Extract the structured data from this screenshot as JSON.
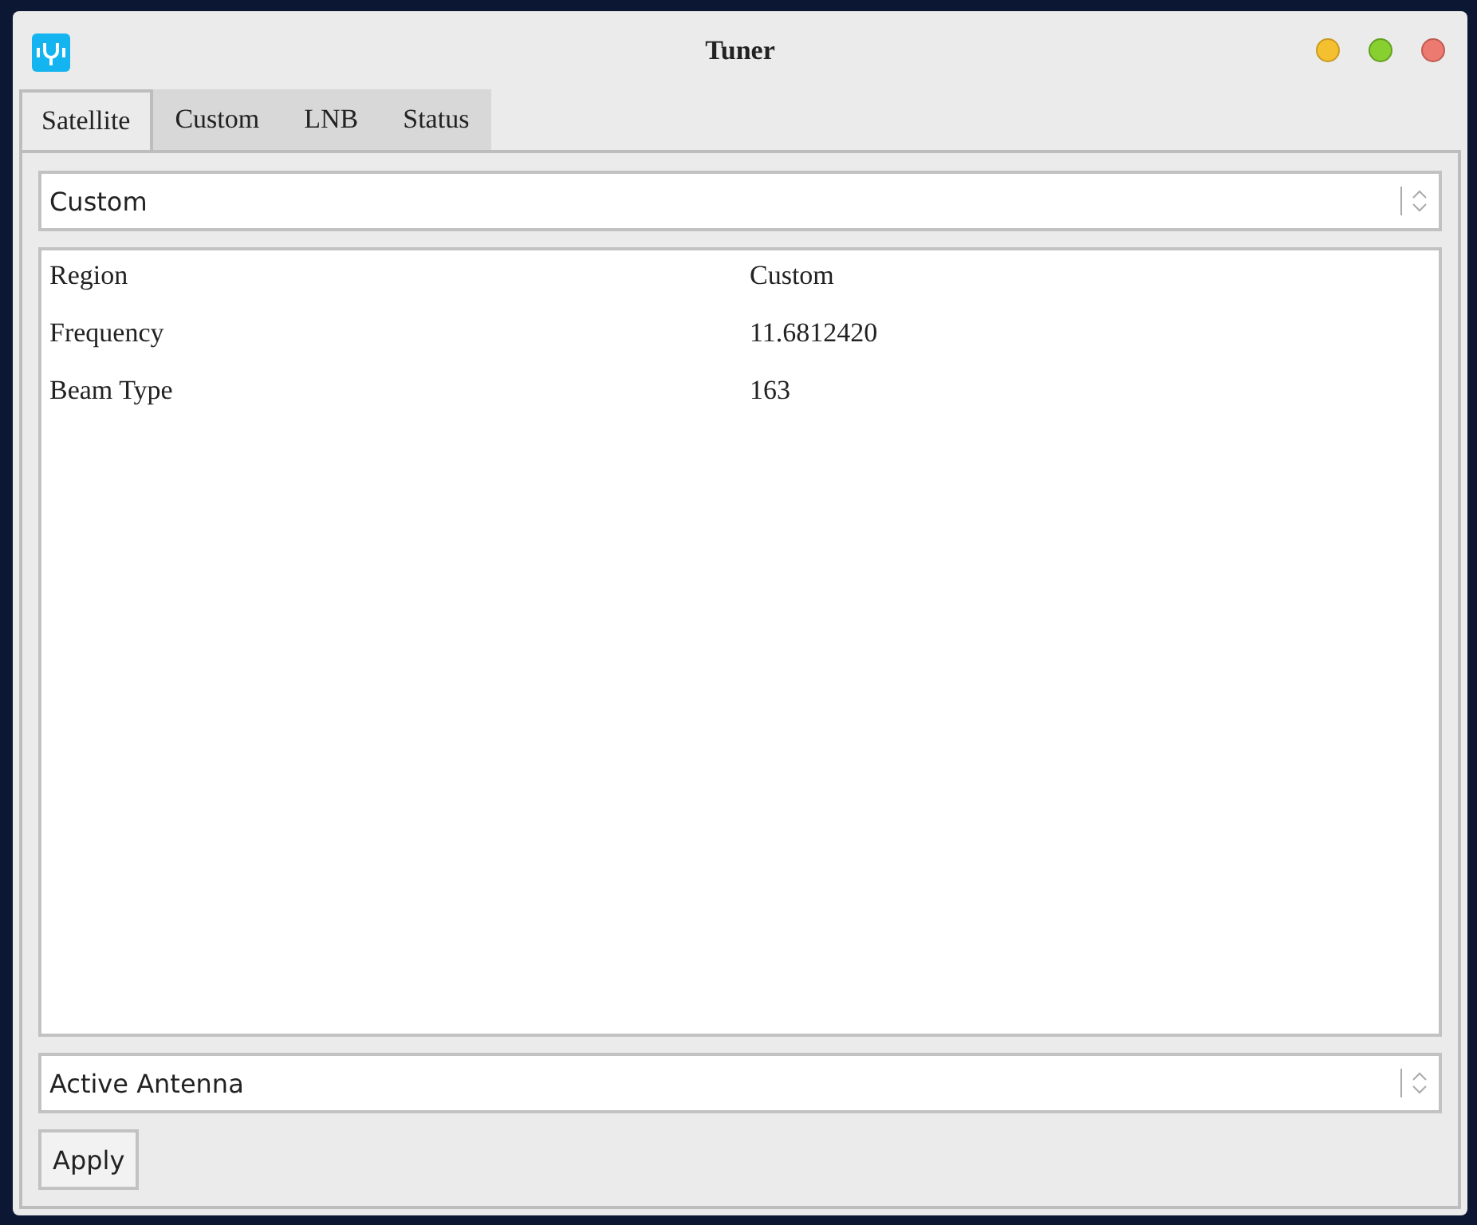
{
  "window": {
    "title": "Tuner"
  },
  "tabs": [
    {
      "label": "Satellite",
      "selected": true
    },
    {
      "label": "Custom",
      "selected": false
    },
    {
      "label": "LNB",
      "selected": false
    },
    {
      "label": "Status",
      "selected": false
    }
  ],
  "satellite_select": {
    "value": "Custom"
  },
  "properties": [
    {
      "name": "Region",
      "value": "Custom"
    },
    {
      "name": "Frequency",
      "value": "11.6812420"
    },
    {
      "name": "Beam Type",
      "value": "163"
    }
  ],
  "antenna_select": {
    "value": "Active Antenna"
  },
  "buttons": [
    "Apply"
  ]
}
